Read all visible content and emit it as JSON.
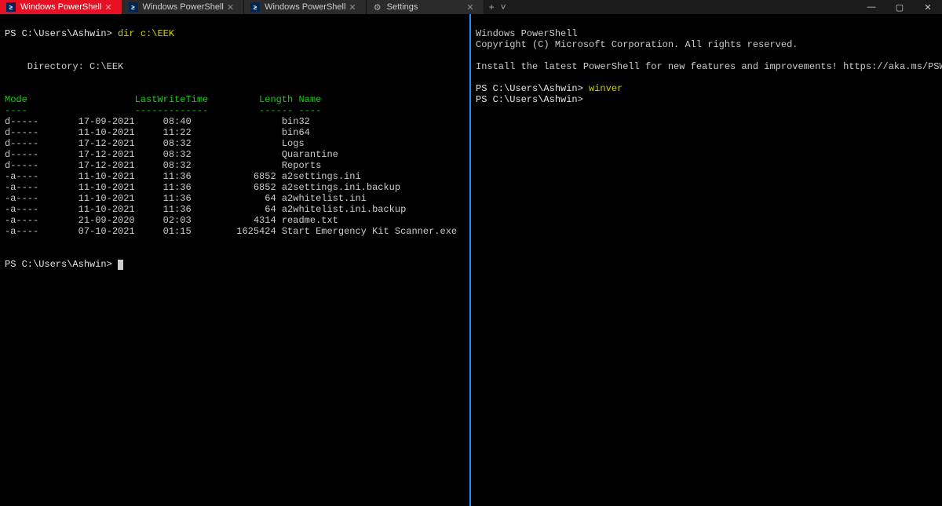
{
  "tabs": [
    {
      "label": "Windows PowerShell",
      "active": true,
      "icon": "ps"
    },
    {
      "label": "Windows PowerShell",
      "active": false,
      "icon": "ps"
    },
    {
      "label": "Windows PowerShell",
      "active": false,
      "icon": "ps"
    },
    {
      "label": "Settings",
      "active": false,
      "icon": "gear"
    }
  ],
  "left": {
    "prompt": "PS C:\\Users\\Ashwin>",
    "command": "dir c:\\EEK",
    "dir_label": "    Directory: C:\\EEK",
    "hdr_mode": "Mode",
    "hdr_lwt": "LastWriteTime",
    "hdr_len": "Length",
    "hdr_name": "Name",
    "rule_mode": "----",
    "rule_lwt": "-------------",
    "rule_len": "------",
    "rule_name": "----",
    "rows": [
      {
        "mode": "d-----",
        "date": "17-09-2021",
        "time": "08:40",
        "len": "",
        "name": "bin32"
      },
      {
        "mode": "d-----",
        "date": "11-10-2021",
        "time": "11:22",
        "len": "",
        "name": "bin64"
      },
      {
        "mode": "d-----",
        "date": "17-12-2021",
        "time": "08:32",
        "len": "",
        "name": "Logs"
      },
      {
        "mode": "d-----",
        "date": "17-12-2021",
        "time": "08:32",
        "len": "",
        "name": "Quarantine"
      },
      {
        "mode": "d-----",
        "date": "17-12-2021",
        "time": "08:32",
        "len": "",
        "name": "Reports"
      },
      {
        "mode": "-a----",
        "date": "11-10-2021",
        "time": "11:36",
        "len": "6852",
        "name": "a2settings.ini"
      },
      {
        "mode": "-a----",
        "date": "11-10-2021",
        "time": "11:36",
        "len": "6852",
        "name": "a2settings.ini.backup"
      },
      {
        "mode": "-a----",
        "date": "11-10-2021",
        "time": "11:36",
        "len": "64",
        "name": "a2whitelist.ini"
      },
      {
        "mode": "-a----",
        "date": "11-10-2021",
        "time": "11:36",
        "len": "64",
        "name": "a2whitelist.ini.backup"
      },
      {
        "mode": "-a----",
        "date": "21-09-2020",
        "time": "02:03",
        "len": "4314",
        "name": "readme.txt"
      },
      {
        "mode": "-a----",
        "date": "07-10-2021",
        "time": "01:15",
        "len": "1625424",
        "name": "Start Emergency Kit Scanner.exe"
      }
    ],
    "prompt2": "PS C:\\Users\\Ashwin>"
  },
  "right": {
    "banner1": "Windows PowerShell",
    "banner2": "Copyright (C) Microsoft Corporation. All rights reserved.",
    "install_msg": "Install the latest PowerShell for new features and improvements! ",
    "install_url": "https://aka.ms/PSWindows",
    "prompt": "PS C:\\Users\\Ashwin>",
    "command": "winver",
    "prompt2": "PS C:\\Users\\Ashwin>"
  }
}
